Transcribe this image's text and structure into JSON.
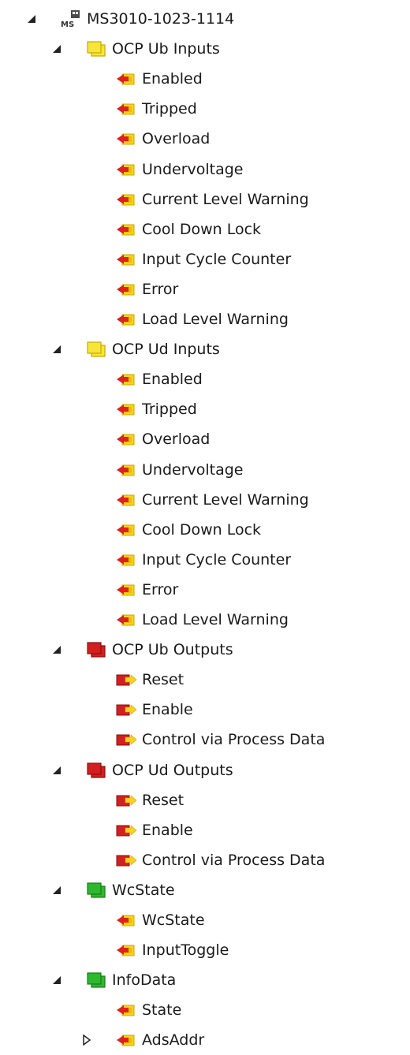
{
  "tree": {
    "root": {
      "label": "MS3010-1023-1114",
      "icon": "ms-device-icon",
      "expanded": true
    },
    "groups": [
      {
        "label": "OCP Ub Inputs",
        "icon": "input-folder-icon",
        "color": "#f7e63a",
        "expanded": true,
        "children": [
          {
            "label": "Enabled",
            "icon": "input-variable-icon"
          },
          {
            "label": "Tripped",
            "icon": "input-variable-icon"
          },
          {
            "label": "Overload",
            "icon": "input-variable-icon"
          },
          {
            "label": "Undervoltage",
            "icon": "input-variable-icon"
          },
          {
            "label": "Current Level Warning",
            "icon": "input-variable-icon"
          },
          {
            "label": "Cool Down Lock",
            "icon": "input-variable-icon"
          },
          {
            "label": "Input Cycle Counter",
            "icon": "input-variable-icon"
          },
          {
            "label": "Error",
            "icon": "input-variable-icon"
          },
          {
            "label": "Load Level Warning",
            "icon": "input-variable-icon"
          }
        ]
      },
      {
        "label": "OCP Ud Inputs",
        "icon": "input-folder-icon",
        "color": "#f7e63a",
        "expanded": true,
        "children": [
          {
            "label": "Enabled",
            "icon": "input-variable-icon"
          },
          {
            "label": "Tripped",
            "icon": "input-variable-icon"
          },
          {
            "label": "Overload",
            "icon": "input-variable-icon"
          },
          {
            "label": "Undervoltage",
            "icon": "input-variable-icon"
          },
          {
            "label": "Current Level Warning",
            "icon": "input-variable-icon"
          },
          {
            "label": "Cool Down Lock",
            "icon": "input-variable-icon"
          },
          {
            "label": "Input Cycle Counter",
            "icon": "input-variable-icon"
          },
          {
            "label": "Error",
            "icon": "input-variable-icon"
          },
          {
            "label": "Load Level Warning",
            "icon": "input-variable-icon"
          }
        ]
      },
      {
        "label": "OCP Ub Outputs",
        "icon": "output-folder-icon",
        "color": "#d21f1f",
        "expanded": true,
        "children": [
          {
            "label": "Reset",
            "icon": "output-variable-icon"
          },
          {
            "label": "Enable",
            "icon": "output-variable-icon"
          },
          {
            "label": "Control via Process Data",
            "icon": "output-variable-icon"
          }
        ]
      },
      {
        "label": "OCP Ud Outputs",
        "icon": "output-folder-icon",
        "color": "#d21f1f",
        "expanded": true,
        "children": [
          {
            "label": "Reset",
            "icon": "output-variable-icon"
          },
          {
            "label": "Enable",
            "icon": "output-variable-icon"
          },
          {
            "label": "Control via Process Data",
            "icon": "output-variable-icon"
          }
        ]
      },
      {
        "label": "WcState",
        "icon": "status-folder-icon",
        "color": "#2eb82e",
        "expanded": true,
        "children": [
          {
            "label": "WcState",
            "icon": "input-variable-icon"
          },
          {
            "label": "InputToggle",
            "icon": "input-variable-icon"
          }
        ]
      },
      {
        "label": "InfoData",
        "icon": "status-folder-icon",
        "color": "#2eb82e",
        "expanded": true,
        "children": [
          {
            "label": "State",
            "icon": "input-variable-icon"
          },
          {
            "label": "AdsAddr",
            "icon": "input-variable-icon",
            "collapsed_toggle": true
          }
        ]
      }
    ]
  }
}
